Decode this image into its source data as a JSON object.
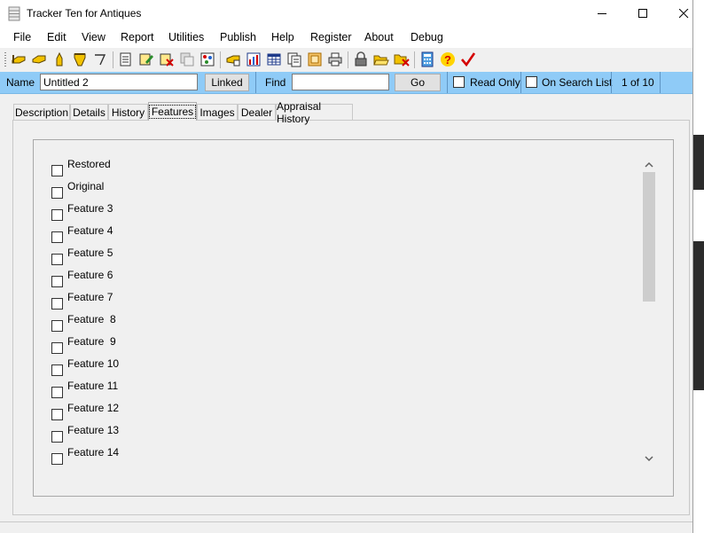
{
  "window": {
    "title": "Tracker Ten for Antiques",
    "icon": "database-icon"
  },
  "menu": [
    "File",
    "Edit",
    "View",
    "Report",
    "Utilities",
    "Publish",
    "Help",
    "Register",
    "About",
    "Debug"
  ],
  "toolbar": {
    "icons": [
      "first-record-icon",
      "previous-record-icon",
      "next-record-icon",
      "last-record-icon",
      "goto-record-icon",
      "add-record-icon",
      "edit-record-icon",
      "delete-record-icon",
      "copy-record-icon",
      "multi-edit-icon",
      "find-icon",
      "chart-icon",
      "table-view-icon",
      "pages-icon",
      "image-icon",
      "print-icon",
      "lock-icon",
      "open-folder-icon",
      "save-icon",
      "calculator-icon",
      "help-icon",
      "check-icon"
    ]
  },
  "infobar": {
    "name_label": "Name",
    "name_value": "Untitled 2",
    "linked_label": "Linked",
    "find_label": "Find",
    "find_value": "",
    "go_label": "Go",
    "read_only_label": "Read Only",
    "on_search_list_label": "On Search List",
    "record_position": "1 of 10",
    "accent_color": "#8fcbf7"
  },
  "tabs": [
    {
      "label": "Description",
      "active": false
    },
    {
      "label": "Details",
      "active": false
    },
    {
      "label": "History",
      "active": false
    },
    {
      "label": "Features",
      "active": true
    },
    {
      "label": "Images",
      "active": false
    },
    {
      "label": "Dealer",
      "active": false
    },
    {
      "label": "Appraisal History",
      "active": false
    }
  ],
  "features": [
    {
      "label": "Restored",
      "checked": false
    },
    {
      "label": "Original",
      "checked": false
    },
    {
      "label": "Feature 3",
      "checked": false
    },
    {
      "label": "Feature 4",
      "checked": false
    },
    {
      "label": "Feature 5",
      "checked": false
    },
    {
      "label": "Feature 6",
      "checked": false
    },
    {
      "label": "Feature 7",
      "checked": false
    },
    {
      "label": "Feature  8",
      "checked": false
    },
    {
      "label": "Feature  9",
      "checked": false
    },
    {
      "label": "Feature 10",
      "checked": false
    },
    {
      "label": "Feature 11",
      "checked": false
    },
    {
      "label": "Feature 12",
      "checked": false
    },
    {
      "label": "Feature 13",
      "checked": false
    },
    {
      "label": "Feature 14",
      "checked": false
    }
  ]
}
